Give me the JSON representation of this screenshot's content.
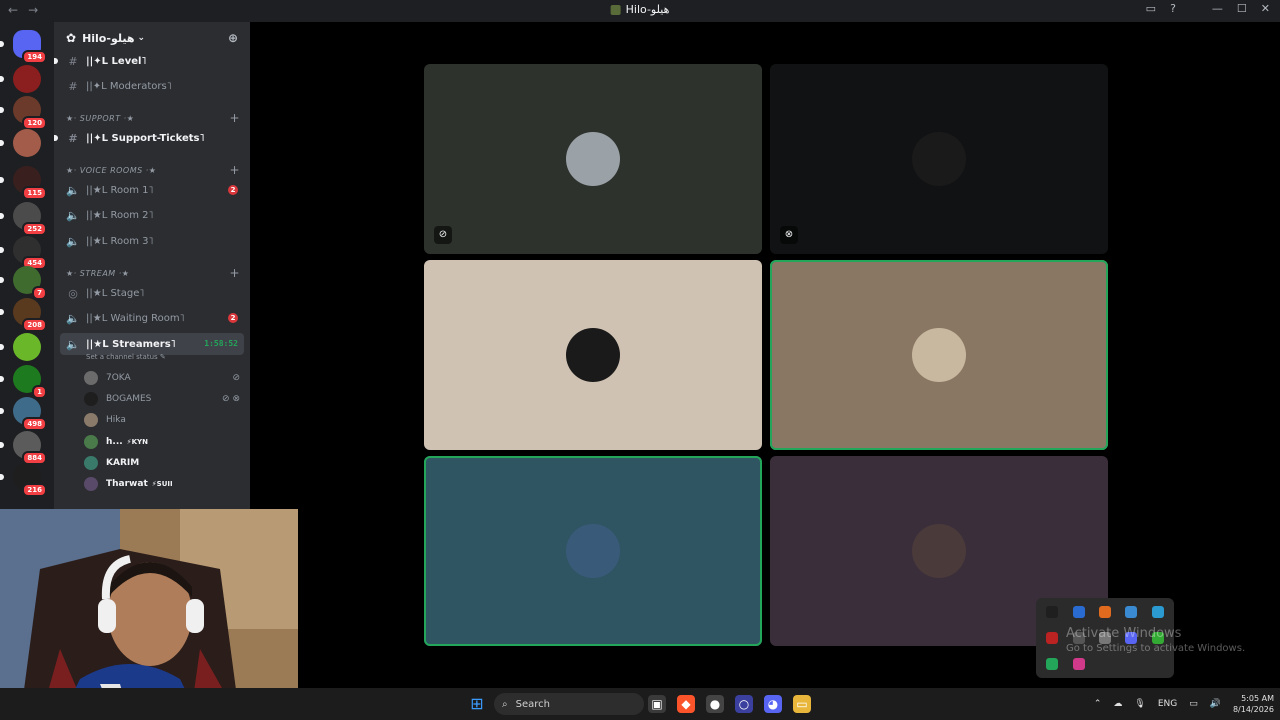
{
  "window": {
    "back_icon": "arrow-left-icon",
    "forward_icon": "arrow-right-icon",
    "title": "Hilo-هيلو",
    "controls": [
      "inbox-icon",
      "help-icon",
      "minimize-icon",
      "maximize-icon",
      "close-icon"
    ]
  },
  "guilds": [
    {
      "badge": "194"
    },
    {
      "badge": ""
    },
    {
      "badge": "120"
    },
    {
      "badge": ""
    },
    {
      "badge": "115"
    },
    {
      "badge": "252"
    },
    {
      "badge": "454"
    },
    {
      "badge": "7"
    },
    {
      "badge": "208"
    },
    {
      "badge": ""
    },
    {
      "badge": "1"
    },
    {
      "badge": "498"
    },
    {
      "badge": "884"
    },
    {
      "badge": "216"
    }
  ],
  "server": {
    "name": "Hilo-هيلو",
    "channels_top": [
      {
        "label": "||✦L Level˥",
        "icon": "hash-icon"
      },
      {
        "label": "||✦L Moderators˥",
        "icon": "hash-icon"
      }
    ],
    "categories": {
      "support": "★· SUPPORT ·★",
      "voice": "★· VOICE ROOMS ·★",
      "stream": "★· STREAM ·★"
    },
    "support_channel": "||✦L Support-Tickets˥",
    "voice_channels": [
      {
        "label": "||★L Room 1˥",
        "count": "2"
      },
      {
        "label": "||★L Room 2˥",
        "count": ""
      },
      {
        "label": "||★L Room 3˥",
        "count": ""
      }
    ],
    "stage_channel": "||★L Stage˥",
    "waiting_room": {
      "label": "||★L Waiting Room˥",
      "count": "2"
    },
    "streamers": {
      "label": "||★L Streamers˥",
      "timer": "1:58:52",
      "status": "Set a channel status"
    },
    "voice_users": [
      {
        "name": "7OKA",
        "tag": "",
        "status": "muted"
      },
      {
        "name": "BOGAMES",
        "tag": "",
        "status": "muted-deafened"
      },
      {
        "name": "Hika",
        "tag": "",
        "status": ""
      },
      {
        "name": "h...",
        "tag": "⚡KYN",
        "status": ""
      },
      {
        "name": "KARIM",
        "tag": "",
        "status": ""
      },
      {
        "name": "Tharwat",
        "tag": "⚡SUII",
        "status": ""
      }
    ]
  },
  "tiles": [
    {
      "name": "tile-1",
      "bg": "#2e322d",
      "speaking": false,
      "indicator": "mic-muted-icon"
    },
    {
      "name": "tile-2",
      "bg": "#111213",
      "speaking": false,
      "indicator": "deafened-icon"
    },
    {
      "name": "tile-3",
      "bg": "#d0c2b2",
      "speaking": false,
      "indicator": ""
    },
    {
      "name": "tile-4",
      "bg": "#8a7763",
      "speaking": true,
      "indicator": ""
    },
    {
      "name": "tile-5",
      "bg": "#2f5563",
      "speaking": true,
      "indicator": ""
    },
    {
      "name": "tile-6",
      "bg": "#3a2e3a",
      "speaking": false,
      "indicator": ""
    }
  ],
  "taskbar": {
    "search_label": "Search",
    "lang": "ENG",
    "time": "5:05 AM",
    "date": "8/14/2026"
  },
  "activation": {
    "line1": "Activate Windows",
    "line2": "Go to Settings to activate Windows."
  }
}
